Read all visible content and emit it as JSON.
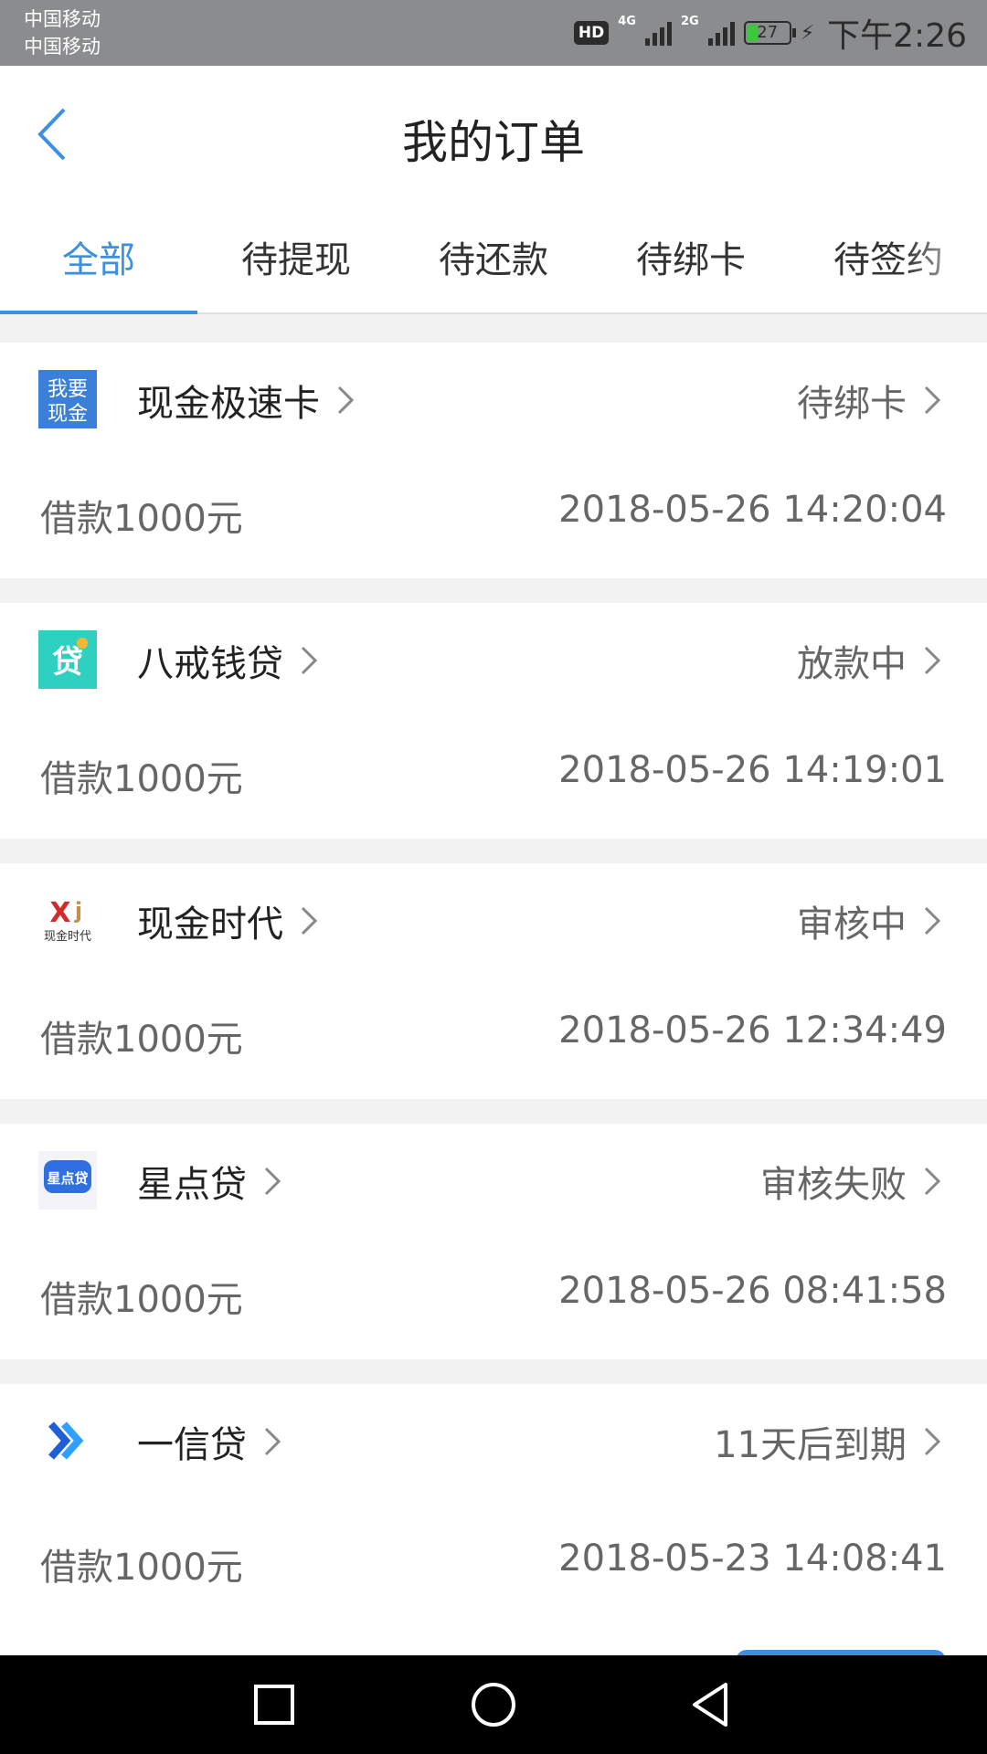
{
  "status_bar": {
    "carrier1": "中国移动",
    "carrier2": "中国移动",
    "hd": "HD",
    "net1": "4G",
    "net2": "2G",
    "battery": "27",
    "battery_level": 0.27,
    "time": "下午2:26"
  },
  "header": {
    "title": "我的订单",
    "back_icon": "chevron-left-icon"
  },
  "tabs": [
    {
      "label": "全部",
      "active": true
    },
    {
      "label": "待提现"
    },
    {
      "label": "待还款"
    },
    {
      "label": "待绑卡"
    },
    {
      "label": "待签约"
    }
  ],
  "orders": [
    {
      "name": "现金极速卡",
      "status": "待绑卡",
      "amount": "借款1000元",
      "time": "2018-05-26 14:20:04",
      "logo_text": "我要现金"
    },
    {
      "name": "八戒钱贷",
      "status": "放款中",
      "amount": "借款1000元",
      "time": "2018-05-26 14:19:01",
      "logo_text": "贷"
    },
    {
      "name": "现金时代",
      "status": "审核中",
      "amount": "借款1000元",
      "time": "2018-05-26 12:34:49",
      "logo_text": "现金时代"
    },
    {
      "name": "星点贷",
      "status": "审核失败",
      "amount": "借款1000元",
      "time": "2018-05-26 08:41:58",
      "logo_text": "星点贷"
    },
    {
      "name": "一信贷",
      "status": "11天后到期",
      "amount": "借款1000元",
      "time": "2018-05-23 14:08:41",
      "logo_text": ""
    }
  ],
  "colors": {
    "accent": "#3d8fe0",
    "divider": "#f2f2f2",
    "status_bar": "#8a8c8e"
  }
}
